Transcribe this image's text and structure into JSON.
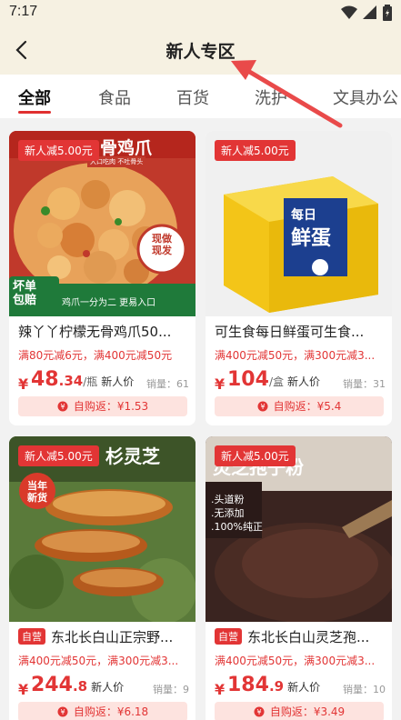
{
  "status": {
    "time": "7:17"
  },
  "header": {
    "title": "新人专区"
  },
  "tabs": [
    {
      "label": "全部",
      "active": true
    },
    {
      "label": "食品",
      "active": false
    },
    {
      "label": "百货",
      "active": false
    },
    {
      "label": "洗护",
      "active": false
    },
    {
      "label": "文具办公",
      "active": false
    }
  ],
  "products": [
    {
      "badge": "新人减5.00元",
      "title": "辣丫丫柠檬无骨鸡爪50...",
      "self_operated": false,
      "promo": "满80元减6元，满400元减50元",
      "price_int": "48",
      "price_dec": ".34",
      "unit": "/瓶",
      "newbie_label": "新人价",
      "sales": "销量：61",
      "rebate": "自购返：¥1.53",
      "image_text": {
        "top": "骨鸡爪",
        "stamp": "现做\n现发",
        "bottom_left": "坏单\n包赔",
        "bottom_right": "鸡爪一分为二 更易入口",
        "strip": "大口吃肉 不吐骨头"
      }
    },
    {
      "badge": "新人减5.00元",
      "title": "可生食每日鲜蛋可生食...",
      "self_operated": false,
      "promo": "满400元减50元，满300元减3...",
      "price_int": "104",
      "price_dec": "",
      "unit": "/盒",
      "newbie_label": "新人价",
      "sales": "销量：31",
      "rebate": "自购返：¥5.4",
      "image_text": {
        "box_big": "每日",
        "box_big2": "鲜蛋"
      }
    },
    {
      "badge": "新人减5.00元",
      "title": "东北长白山正宗野...",
      "self_operated": true,
      "self_tag": "自营",
      "promo": "满400元减50元，满300元减3...",
      "price_int": "244",
      "price_dec": ".8",
      "unit": "",
      "newbie_label": "新人价",
      "sales": "销量：9",
      "rebate": "自购返：¥6.18",
      "image_text": {
        "top": "杉灵芝",
        "circle": "当年\n新货"
      }
    },
    {
      "badge": "新人减5.00元",
      "title": "东北长白山灵芝孢...",
      "self_operated": true,
      "self_tag": "自营",
      "promo": "满400元减50元，满300元减3...",
      "price_int": "184",
      "price_dec": ".9",
      "unit": "",
      "newbie_label": "新人价",
      "sales": "销量：10",
      "rebate": "自购返：¥3.49",
      "image_text": {
        "top": "灵芝孢子粉",
        "lines": [
          ".头道粉",
          ".无添加",
          ".100%纯正"
        ]
      }
    }
  ],
  "colors": {
    "accent": "#e23535",
    "header_bg": "#f6f1e2",
    "rebate_bg": "#fde3df"
  }
}
